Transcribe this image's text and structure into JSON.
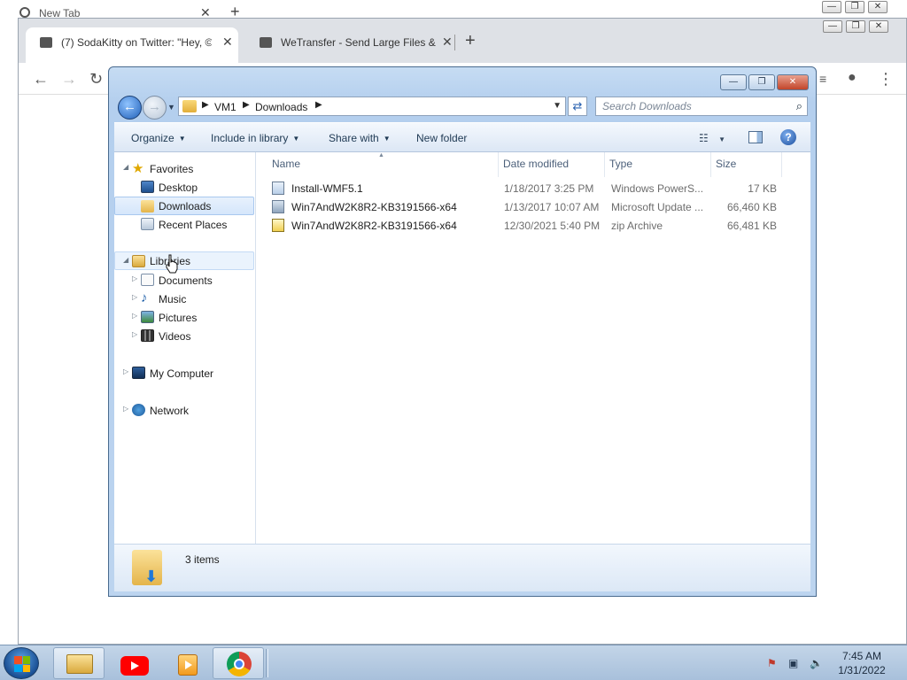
{
  "chrome_back": {
    "tab_title": "New Tab",
    "window_buttons": [
      "—",
      "❐",
      "✕"
    ]
  },
  "chrome_front": {
    "tabs": [
      {
        "title": "(7) SodaKitty on Twitter: \"Hey, ©"
      },
      {
        "title": "WeTransfer - Send Large Files &"
      }
    ],
    "new_tab_symbol": "+",
    "tab_close_symbol": "✕",
    "nav": {
      "back": "←",
      "forward": "→",
      "reload": "↻"
    },
    "window_buttons": [
      "—",
      "❐",
      "✕"
    ],
    "toolbar_right": {
      "menu": "⋮",
      "profile": "●",
      "media": "≡"
    }
  },
  "explorer": {
    "caption_buttons": {
      "minimize": "—",
      "maximize": "❐",
      "close": "✕"
    },
    "breadcrumb": [
      "VM1",
      "Downloads"
    ],
    "search_placeholder": "Search Downloads",
    "commands": {
      "organize": "Organize",
      "include_in_library": "Include in library",
      "share_with": "Share with",
      "new_folder": "New folder"
    },
    "help": "?",
    "nav_pane": {
      "favorites": {
        "label": "Favorites",
        "items": [
          "Desktop",
          "Downloads",
          "Recent Places"
        ]
      },
      "libraries": {
        "label": "Libraries",
        "items": [
          "Documents",
          "Music",
          "Pictures",
          "Videos"
        ]
      },
      "computer": "My Computer",
      "network": "Network"
    },
    "columns": {
      "name": "Name",
      "date": "Date modified",
      "type": "Type",
      "size": "Size"
    },
    "files": [
      {
        "name": "Install-WMF5.1",
        "date": "1/18/2017 3:25 PM",
        "type": "Windows PowerS...",
        "size": "17 KB",
        "icon": "powershell-script-icon"
      },
      {
        "name": "Win7AndW2K8R2-KB3191566-x64",
        "date": "1/13/2017 10:07 AM",
        "type": "Microsoft Update ...",
        "size": "66,460 KB",
        "icon": "msu-update-icon"
      },
      {
        "name": "Win7AndW2K8R2-KB3191566-x64",
        "date": "12/30/2021 5:40 PM",
        "type": "zip Archive",
        "size": "66,481 KB",
        "icon": "zip-archive-icon"
      }
    ],
    "status": {
      "item_count": "3 items"
    }
  },
  "taskbar": {
    "apps": [
      "file-explorer",
      "youtube",
      "media-player",
      "chrome"
    ],
    "clock": {
      "time": "7:45 AM",
      "date": "1/31/2022"
    }
  },
  "colors": {
    "explorer_frame": "#b4cfee",
    "selection": "#d5e6fb",
    "taskbar": "#a8c0db",
    "youtube_red": "#ff0000"
  }
}
